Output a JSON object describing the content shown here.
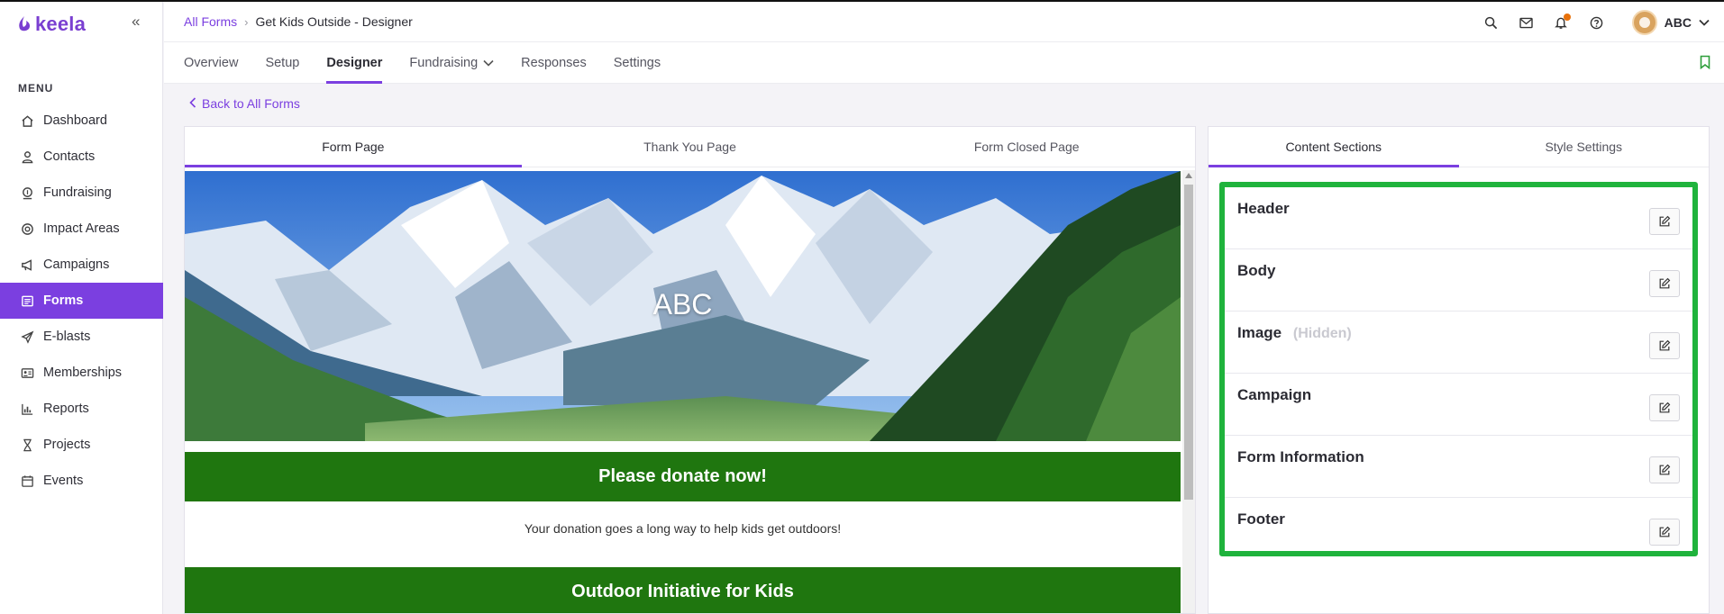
{
  "app": {
    "logo_text": "keela",
    "collapse_icon": "double-chevron-left-icon"
  },
  "sidebar": {
    "menu_title": "MENU",
    "items": [
      {
        "label": "Dashboard",
        "icon": "home-icon",
        "active": false
      },
      {
        "label": "Contacts",
        "icon": "user-icon",
        "active": false
      },
      {
        "label": "Fundraising",
        "icon": "donation-icon",
        "active": false
      },
      {
        "label": "Impact Areas",
        "icon": "impact-icon",
        "active": false
      },
      {
        "label": "Campaigns",
        "icon": "megaphone-icon",
        "active": false
      },
      {
        "label": "Forms",
        "icon": "form-icon",
        "active": true
      },
      {
        "label": "E-blasts",
        "icon": "paper-plane-icon",
        "active": false
      },
      {
        "label": "Memberships",
        "icon": "id-card-icon",
        "active": false
      },
      {
        "label": "Reports",
        "icon": "bar-chart-icon",
        "active": false
      },
      {
        "label": "Projects",
        "icon": "hourglass-icon",
        "active": false
      },
      {
        "label": "Events",
        "icon": "calendar-icon",
        "active": false
      }
    ]
  },
  "header": {
    "breadcrumb_link": "All Forms",
    "breadcrumb_current": "Get Kids Outside - Designer",
    "user_name": "ABC"
  },
  "tabs": [
    {
      "label": "Overview",
      "active": false
    },
    {
      "label": "Setup",
      "active": false
    },
    {
      "label": "Designer",
      "active": true
    },
    {
      "label": "Fundraising",
      "active": false,
      "dropdown": true
    },
    {
      "label": "Responses",
      "active": false
    },
    {
      "label": "Settings",
      "active": false
    }
  ],
  "back_link": "Back to All Forms",
  "preview": {
    "tabs": [
      {
        "label": "Form Page",
        "active": true
      },
      {
        "label": "Thank You Page",
        "active": false
      },
      {
        "label": "Form Closed Page",
        "active": false
      }
    ],
    "banner_text": "ABC",
    "donate_heading": "Please donate now!",
    "body_text": "Your donation goes a long way to help kids get outdoors!",
    "campaign_heading": "Outdoor Initiative for Kids",
    "accent_green": "#1f760f"
  },
  "side_panel": {
    "tabs": [
      {
        "label": "Content Sections",
        "active": true
      },
      {
        "label": "Style Settings",
        "active": false
      }
    ],
    "sections": [
      {
        "title": "Header",
        "hidden_label": ""
      },
      {
        "title": "Body",
        "hidden_label": ""
      },
      {
        "title": "Image",
        "hidden_label": "(Hidden)"
      },
      {
        "title": "Campaign",
        "hidden_label": ""
      },
      {
        "title": "Form Information",
        "hidden_label": ""
      },
      {
        "title": "Footer",
        "hidden_label": ""
      }
    ],
    "highlight_color": "#1fb33c"
  },
  "colors": {
    "brand_purple": "#7b3fe0",
    "notification": "#e8710a"
  }
}
